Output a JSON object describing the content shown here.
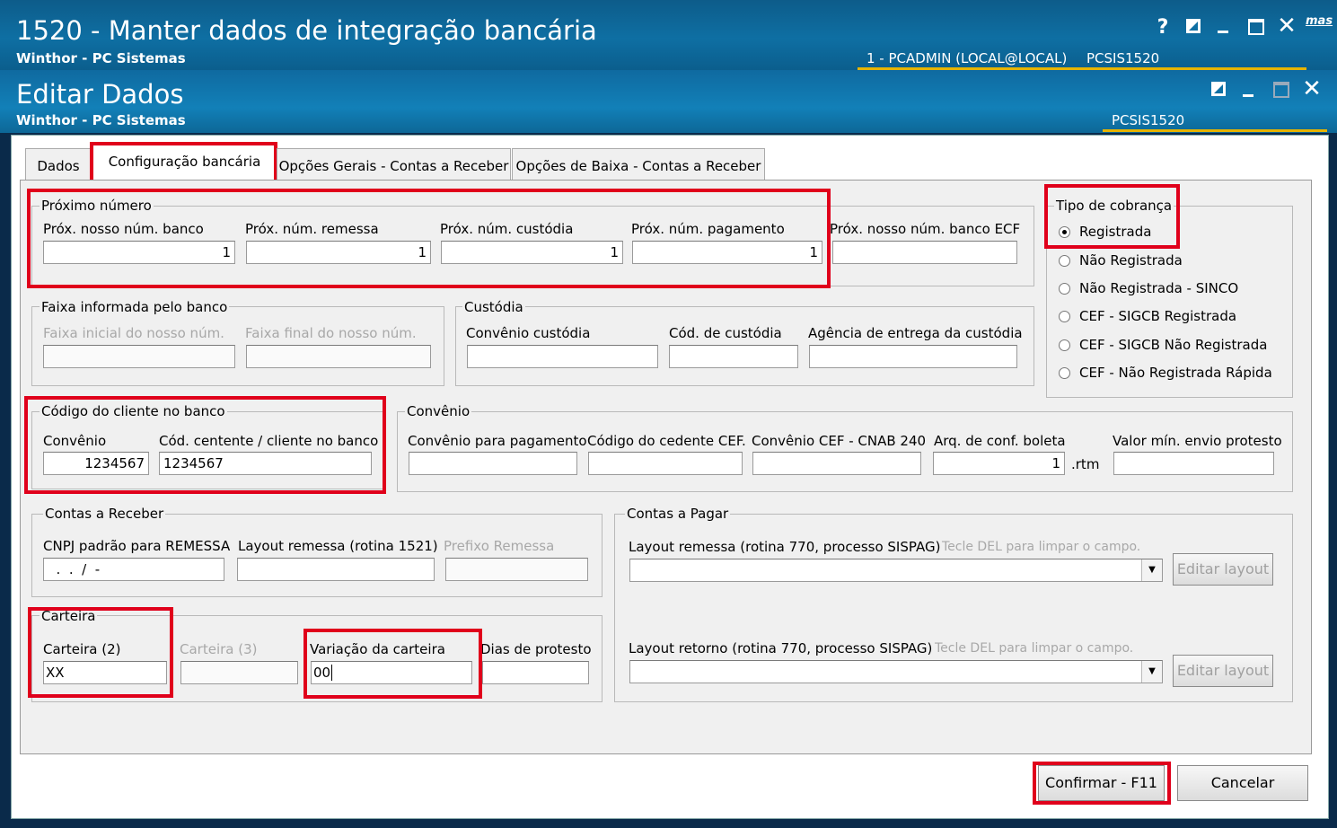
{
  "main_window": {
    "title": "1520 - Manter dados de integração bancária",
    "subtitle": "Winthor - PC Sistemas",
    "user": "1 - PCADMIN (LOCAL@LOCAL)",
    "routine": "PCSIS1520",
    "help_glyph": "?",
    "corner_text": "mas"
  },
  "dialog": {
    "title": "Editar Dados",
    "subtitle": "Winthor - PC Sistemas",
    "routine": "PCSIS1520"
  },
  "tabs": [
    "Dados",
    "Configuração bancária",
    "Opções Gerais - Contas a Receber",
    "Opções de Baixa - Contas a Receber"
  ],
  "proximo_numero": {
    "title": "Próximo número",
    "fields": [
      {
        "label": "Próx. nosso núm. banco",
        "value": "1"
      },
      {
        "label": "Próx. núm. remessa",
        "value": "1"
      },
      {
        "label": "Próx. núm. custódia",
        "value": "1"
      },
      {
        "label": "Próx. núm. pagamento",
        "value": "1"
      },
      {
        "label": "Próx. nosso núm. banco ECF",
        "value": ""
      }
    ]
  },
  "faixa": {
    "title": "Faixa informada pelo banco",
    "inicial_label": "Faixa inicial do nosso núm.",
    "final_label": "Faixa final do nosso núm."
  },
  "custodia": {
    "title": "Custódia",
    "convenio_label": "Convênio custódia",
    "codigo_label": "Cód. de custódia",
    "agencia_label": "Agência de entrega da custódia"
  },
  "tipo_cobranca": {
    "title": "Tipo de cobrança",
    "options": [
      "Registrada",
      "Não Registrada",
      "Não Registrada - SINCO",
      "CEF - SIGCB Registrada",
      "CEF - SIGCB Não Registrada",
      "CEF - Não Registrada Rápida"
    ],
    "selected": "Registrada"
  },
  "codigo_cliente": {
    "title": "Código do cliente no banco",
    "convenio_label": "Convênio",
    "convenio_value": "1234567",
    "cedente_label": "Cód. centente / cliente no banco",
    "cedente_value": "1234567"
  },
  "convenio": {
    "title": "Convênio",
    "pagamento_label": "Convênio para pagamento",
    "cedente_cef_label": "Código do cedente CEF.",
    "cnab_label": "Convênio CEF - CNAB 240",
    "arq_label": "Arq. de conf. boleta",
    "arq_value": "1",
    "arq_ext": ".rtm",
    "valor_min_label": "Valor mín. envio protesto"
  },
  "contas_receber": {
    "title": "Contas a Receber",
    "cnpj_label": "CNPJ padrão para REMESSA",
    "cnpj_value": "  .  .  /  -",
    "layout_label": "Layout remessa (rotina 1521)",
    "prefixo_label": "Prefixo Remessa"
  },
  "carteira": {
    "title": "Carteira",
    "c2_label": "Carteira (2)",
    "c2_value": "XX",
    "c3_label": "Carteira (3)",
    "variacao_label": "Variação da carteira",
    "variacao_value": "00",
    "dias_label": "Dias de protesto"
  },
  "contas_pagar": {
    "title": "Contas a Pagar",
    "remessa_label": "Layout remessa (rotina 770, processo SISPAG)",
    "remessa_hint": "Tecle DEL para limpar o campo.",
    "retorno_label": "Layout retorno (rotina 770, processo SISPAG)",
    "retorno_hint": "Tecle DEL para limpar o campo.",
    "edit_label": "Editar layout"
  },
  "buttons": {
    "confirm": "Confirmar - F11",
    "cancel": "Cancelar"
  },
  "colors": {
    "highlight": "#e0001b",
    "titlebar": "#0e6fa3",
    "accent_line": "#e7b400"
  }
}
